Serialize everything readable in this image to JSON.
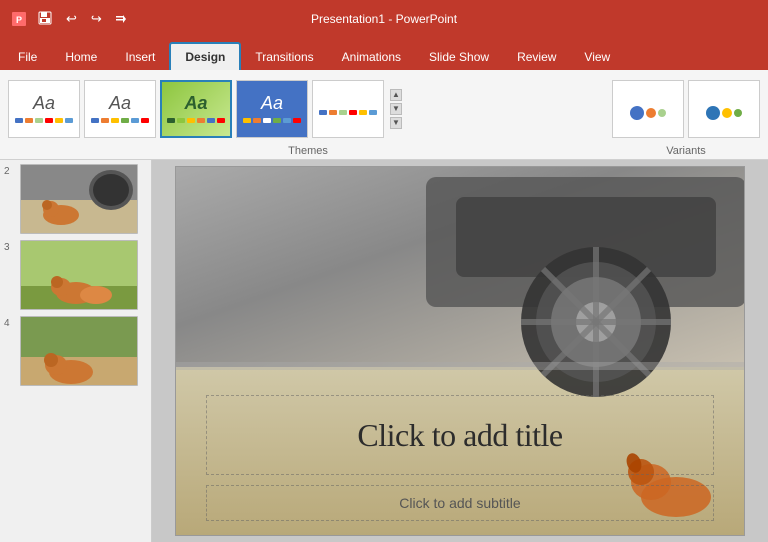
{
  "titlebar": {
    "title": "Presentation1 - PowerPoint",
    "save_icon": "💾",
    "undo_icon": "↩",
    "redo_icon": "↪",
    "customize_icon": "⚙"
  },
  "ribbon": {
    "tabs": [
      {
        "id": "file",
        "label": "File"
      },
      {
        "id": "home",
        "label": "Home"
      },
      {
        "id": "insert",
        "label": "Insert"
      },
      {
        "id": "design",
        "label": "Design",
        "active": true
      },
      {
        "id": "transitions",
        "label": "Transitions"
      },
      {
        "id": "animations",
        "label": "Animations"
      },
      {
        "id": "slideshow",
        "label": "Slide Show"
      },
      {
        "id": "review",
        "label": "Review"
      },
      {
        "id": "view",
        "label": "View"
      }
    ],
    "themes_label": "Themes",
    "variants_label": "Variants",
    "themes": [
      {
        "id": 1,
        "label": "Aa",
        "type": "plain"
      },
      {
        "id": 2,
        "label": "Aa",
        "type": "plain"
      },
      {
        "id": 3,
        "label": "Aa",
        "type": "green",
        "selected": true
      },
      {
        "id": 4,
        "label": "Aa",
        "type": "blue"
      },
      {
        "id": 5,
        "label": "",
        "type": "plain"
      },
      {
        "id": 6,
        "label": "",
        "type": "plain"
      }
    ]
  },
  "slides": [
    {
      "num": "2",
      "type": "dog1"
    },
    {
      "num": "3",
      "type": "dog2"
    },
    {
      "num": "4",
      "type": "dog3"
    }
  ],
  "canvas": {
    "title_placeholder": "Click to add title",
    "subtitle_placeholder": "Click to add subtitle"
  }
}
